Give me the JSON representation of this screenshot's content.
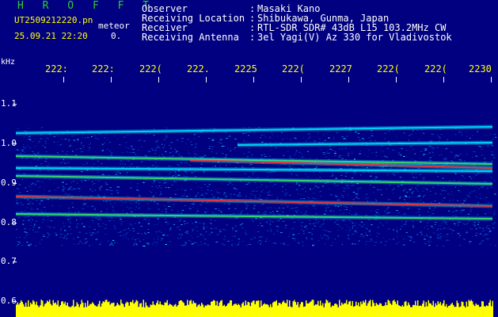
{
  "app": {
    "brand": "H R O F F T",
    "filename": "UT2509212220.pn",
    "kind": "meteor",
    "datetime": "25.09.21 22:20",
    "counter": "0."
  },
  "station": {
    "rows": [
      {
        "key": "Observer",
        "value": "Masaki Kano"
      },
      {
        "key": "Receiving Location",
        "value": "Shibukawa, Gunma, Japan"
      },
      {
        "key": "Receiver",
        "value": "RTL-SDR SDR# 43dB L15 103.2MHz CW"
      },
      {
        "key": "Receiving Antenna",
        "value": "3el Yagi(V) Az 330 for Vladivostok"
      }
    ]
  },
  "axes": {
    "y_unit": "kHz",
    "y_ticks": [
      "1.1",
      "1.0",
      "0.9",
      "0.8",
      "0.7",
      "0.6"
    ],
    "x_ticks": [
      "222:",
      "222:",
      "222(",
      "222.",
      "2225",
      "222(",
      "2227",
      "222(",
      "222(",
      "2230"
    ]
  },
  "colors": {
    "background": "#000080",
    "label_yellow": "#ffff00",
    "brand_green": "#33cc33",
    "echo_red": "#ff3030",
    "echo_green": "#40e060",
    "noise_yellow": "#ffff00"
  }
}
